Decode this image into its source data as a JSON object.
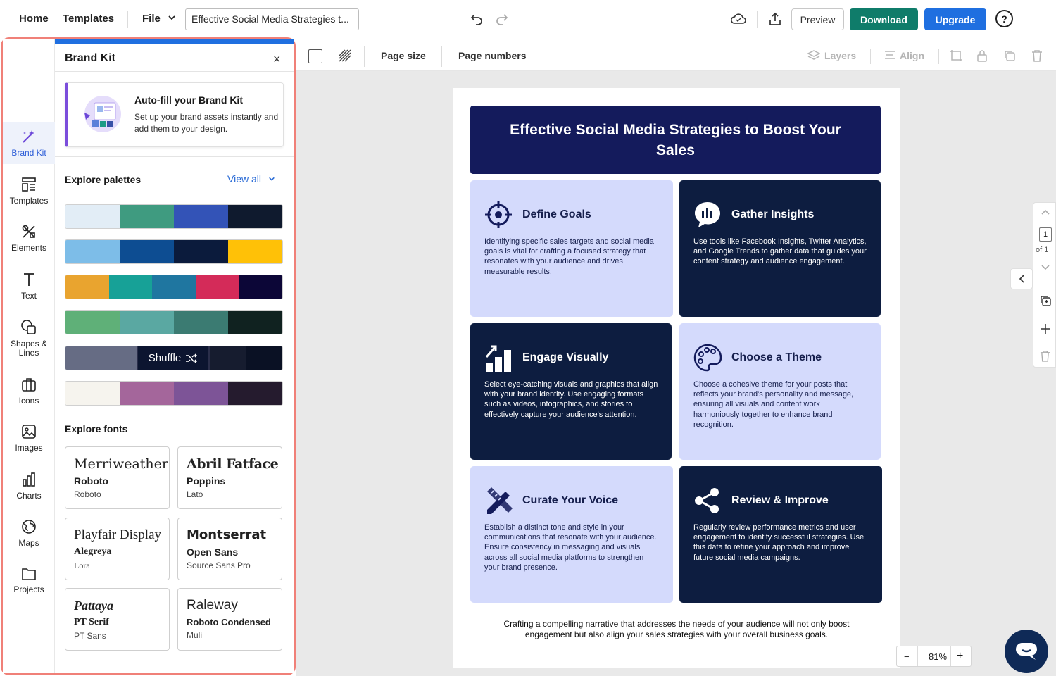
{
  "topbar": {
    "home": "Home",
    "templates": "Templates",
    "file": "File",
    "doc_title": "Effective Social Media Strategies t...",
    "preview": "Preview",
    "download": "Download",
    "upgrade": "Upgrade",
    "help": "?"
  },
  "rail": {
    "items": [
      {
        "label": "Brand Kit",
        "icon": "magic-wand-icon"
      },
      {
        "label": "Templates",
        "icon": "templates-icon"
      },
      {
        "label": "Elements",
        "icon": "elements-icon"
      },
      {
        "label": "Text",
        "icon": "text-icon"
      },
      {
        "label": "Shapes &\nLines",
        "icon": "shapes-icon"
      },
      {
        "label": "Icons",
        "icon": "briefcase-icon"
      },
      {
        "label": "Images",
        "icon": "image-icon"
      },
      {
        "label": "Charts",
        "icon": "bar-chart-icon"
      },
      {
        "label": "Maps",
        "icon": "globe-icon"
      },
      {
        "label": "Projects",
        "icon": "folder-icon"
      }
    ]
  },
  "panel": {
    "title": "Brand Kit",
    "close": "×",
    "autofill_title": "Auto-fill your Brand Kit",
    "autofill_desc": "Set up your brand assets instantly and add them to your design.",
    "explore_palettes": "Explore palettes",
    "view_all": "View all",
    "shuffle": "Shuffle",
    "palettes": [
      [
        "#e2edf6",
        "#3f9b80",
        "#3353b7",
        "#0f1a2e"
      ],
      [
        "#7dbde8",
        "#0d4d92",
        "#0b1b3c",
        "#ffc107"
      ],
      [
        "#e9a42f",
        "#17a197",
        "#1f76a0",
        "#d42b59",
        "#0c0637"
      ],
      [
        "#5fb078",
        "#5aa8a2",
        "#3b7b72",
        "#102220"
      ],
      [
        "#666c84",
        "#2a2e4a",
        "#161c2f",
        "#0a1124"
      ],
      [
        "#f6f4ee",
        "#a4669b",
        "#7d5497",
        "#251b2e"
      ]
    ],
    "explore_fonts": "Explore fonts",
    "fonts": [
      {
        "primary": "Merriweather",
        "secondary": "Roboto",
        "tertiary": "Roboto"
      },
      {
        "primary": "Abril Fatface",
        "secondary": "Poppins",
        "tertiary": "Lato"
      },
      {
        "primary": "Playfair Display",
        "secondary": "Alegreya",
        "tertiary": "Lora"
      },
      {
        "primary": "Montserrat",
        "secondary": "Open Sans",
        "tertiary": "Source Sans Pro"
      },
      {
        "primary": "Pattaya",
        "secondary": "PT Serif",
        "tertiary": "PT Sans"
      },
      {
        "primary": "Raleway",
        "secondary": "Roboto Condensed",
        "tertiary": "Muli"
      }
    ]
  },
  "toolbar": {
    "page_size": "Page size",
    "page_numbers": "Page numbers",
    "layers": "Layers",
    "align": "Align"
  },
  "document": {
    "title": "Effective Social Media Strategies to Boost Your Sales",
    "cards": [
      {
        "title": "Define Goals",
        "text": "Identifying specific sales targets and social media goals is vital for crafting a focused strategy that resonates with your audience and drives measurable results.",
        "theme": "light",
        "icon": "target-icon"
      },
      {
        "title": "Gather Insights",
        "text": "Use tools like Facebook Insights, Twitter Analytics, and Google Trends to gather data that guides your content strategy and audience engagement.",
        "theme": "dark",
        "icon": "chat-chart-icon"
      },
      {
        "title": "Engage Visually",
        "text": "Select eye-catching visuals and graphics that align with your brand identity. Use engaging formats such as videos, infographics, and stories to effectively capture your audience's attention.",
        "theme": "dark",
        "icon": "growth-chart-icon"
      },
      {
        "title": "Choose a Theme",
        "text": "Choose a cohesive theme for your posts that reflects your brand's personality and message, ensuring all visuals and content work harmoniously together to enhance brand recognition.",
        "theme": "light",
        "icon": "palette-icon"
      },
      {
        "title": "Curate Your Voice",
        "text": "Establish a distinct tone and style in your communications that resonate with your audience. Ensure consistency in messaging and visuals across all social media platforms to strengthen your brand presence.",
        "theme": "light",
        "icon": "pencil-ruler-icon"
      },
      {
        "title": "Review & Improve",
        "text": "Regularly review performance metrics and user engagement to identify successful strategies. Use this data to refine your approach and improve future social media campaigns.",
        "theme": "dark",
        "icon": "share-icon"
      }
    ],
    "footer": "Crafting a compelling narrative that addresses the needs of your audience will not only boost engagement but also align your sales strategies with your overall business goals."
  },
  "pager": {
    "page": "1",
    "of": "of 1"
  },
  "zoom": {
    "minus": "−",
    "value": "81%",
    "plus": "+"
  }
}
